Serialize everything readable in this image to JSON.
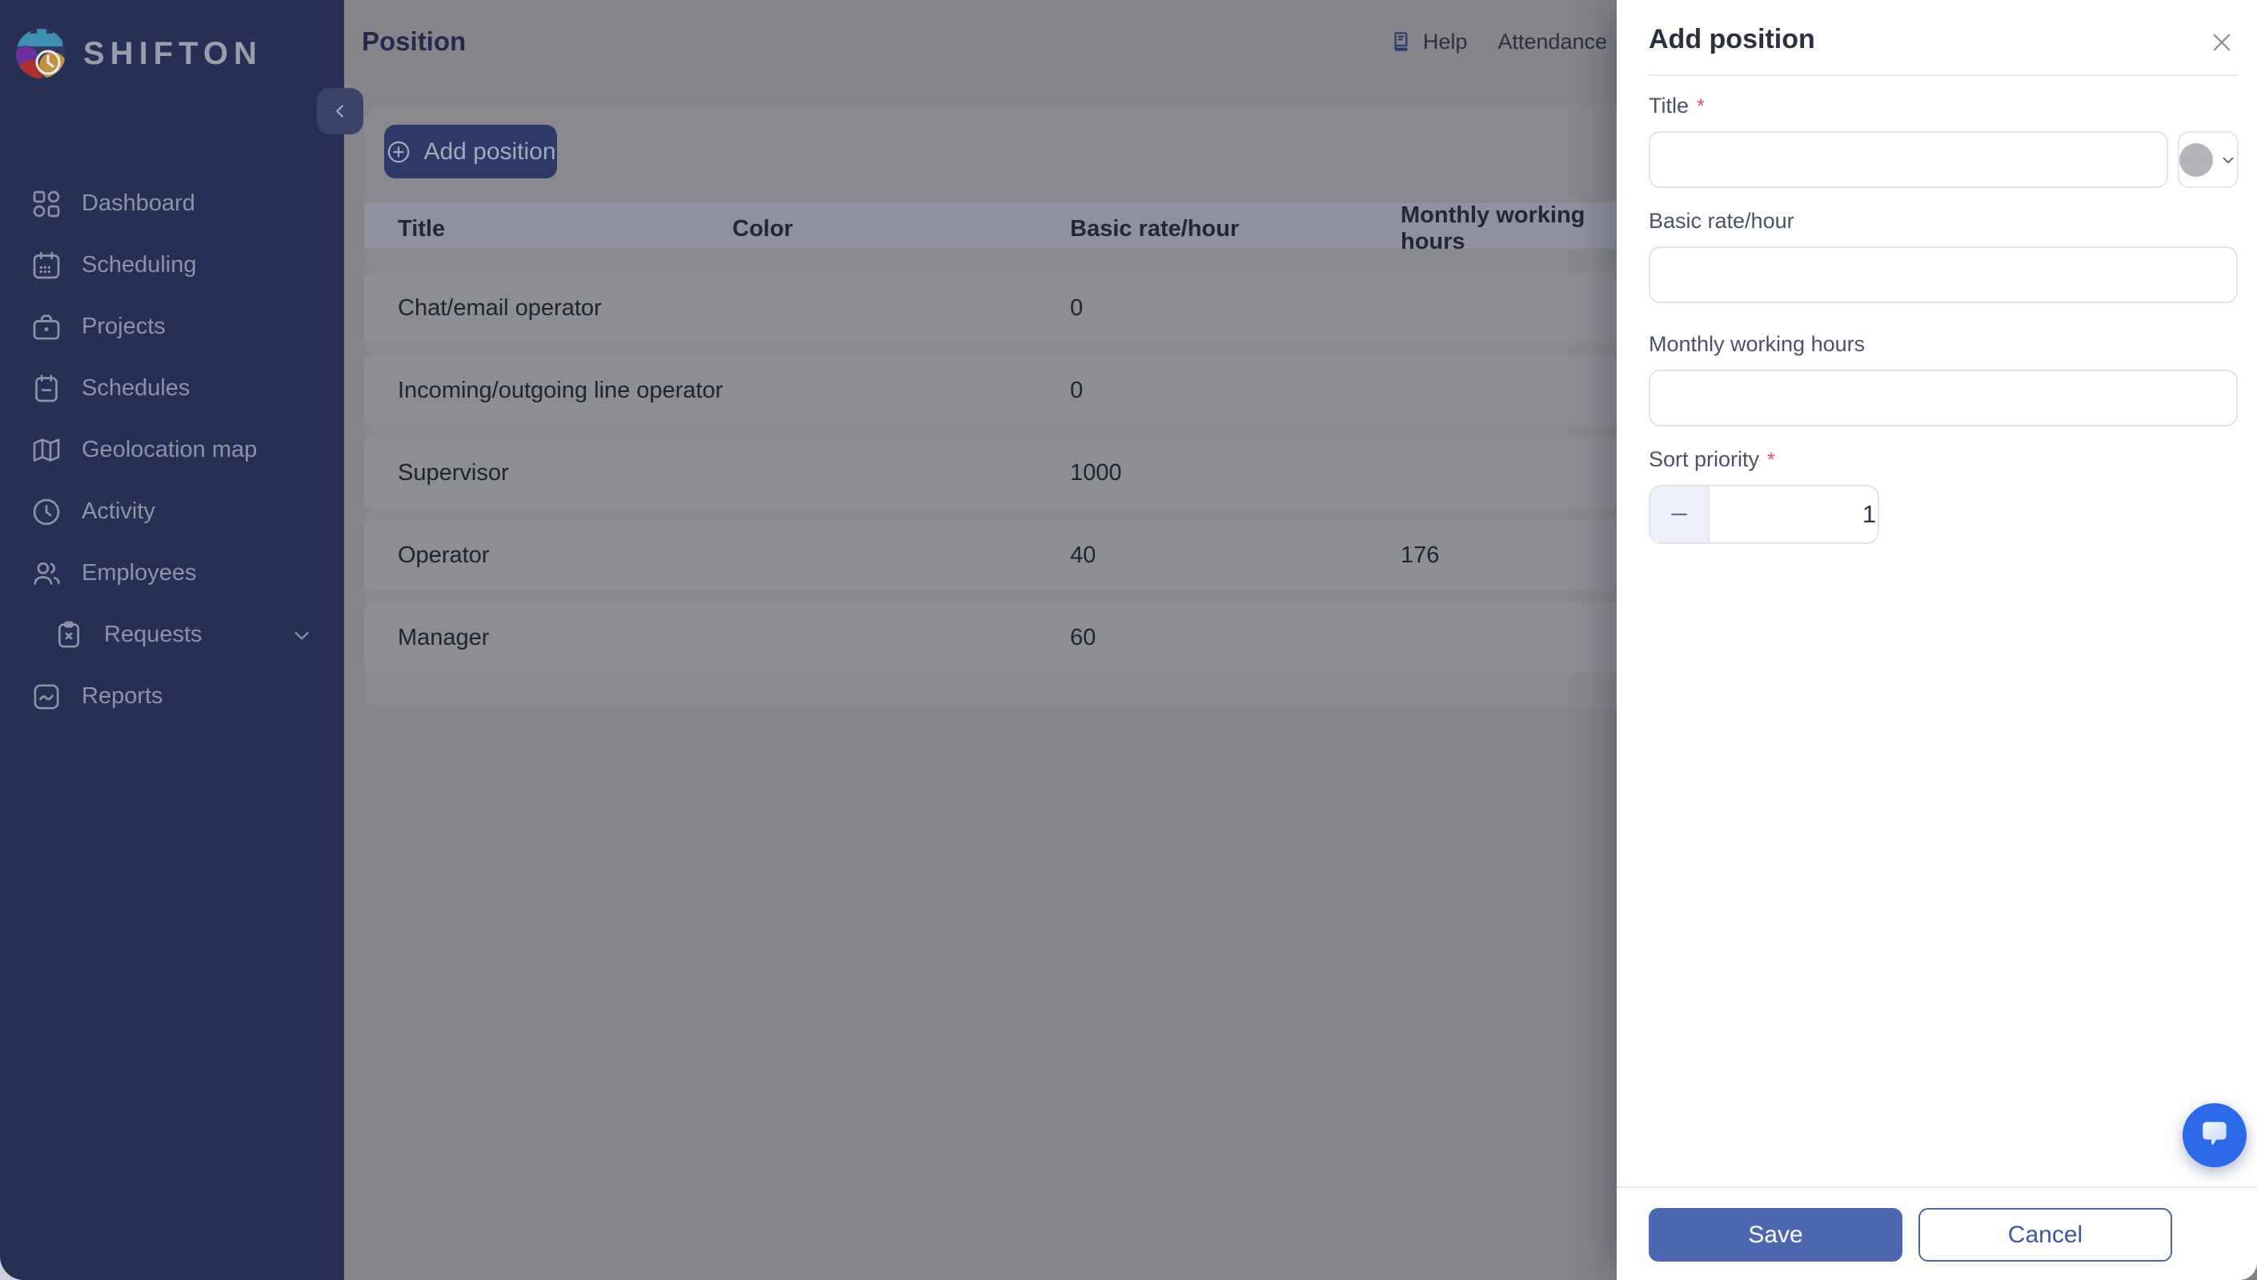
{
  "app": {
    "name": "SHIFTON"
  },
  "colors": {
    "sidebar_bg": "#272f54",
    "accent_navy": "#2d3a67",
    "save_blue": "#4c66b0",
    "chat_blue": "#2c69e8",
    "required_red": "#f5455c"
  },
  "sidebar": {
    "items": [
      {
        "label": "Dashboard"
      },
      {
        "label": "Scheduling"
      },
      {
        "label": "Projects"
      },
      {
        "label": "Schedules"
      },
      {
        "label": "Geolocation map"
      },
      {
        "label": "Activity"
      },
      {
        "label": "Employees"
      },
      {
        "label": "Requests"
      },
      {
        "label": "Reports"
      }
    ]
  },
  "header": {
    "title": "Position",
    "help": "Help",
    "attendance": "Attendance"
  },
  "content": {
    "add_button": "Add position"
  },
  "table": {
    "columns": [
      "Title",
      "Color",
      "Basic rate/hour",
      "Monthly working hours"
    ],
    "rows": [
      {
        "title": "Chat/email operator",
        "color": "#6a9d63",
        "rate": "0",
        "hours": ""
      },
      {
        "title": "Incoming/outgoing line operator",
        "color": "#a87e8b",
        "rate": "0",
        "hours": ""
      },
      {
        "title": "Supervisor",
        "color": "#9b3122",
        "rate": "1000",
        "hours": ""
      },
      {
        "title": "Operator",
        "color": "#6d79b5",
        "rate": "40",
        "hours": "176"
      },
      {
        "title": "Manager",
        "color": "#a7a433",
        "rate": "60",
        "hours": ""
      }
    ]
  },
  "panel": {
    "title": "Add position",
    "required_mark": "*",
    "fields": {
      "title_label": "Title",
      "rate_label": "Basic rate/hour",
      "hours_label": "Monthly working hours",
      "sort_label": "Sort priority"
    },
    "sort_value": "1",
    "save": "Save",
    "cancel": "Cancel"
  }
}
